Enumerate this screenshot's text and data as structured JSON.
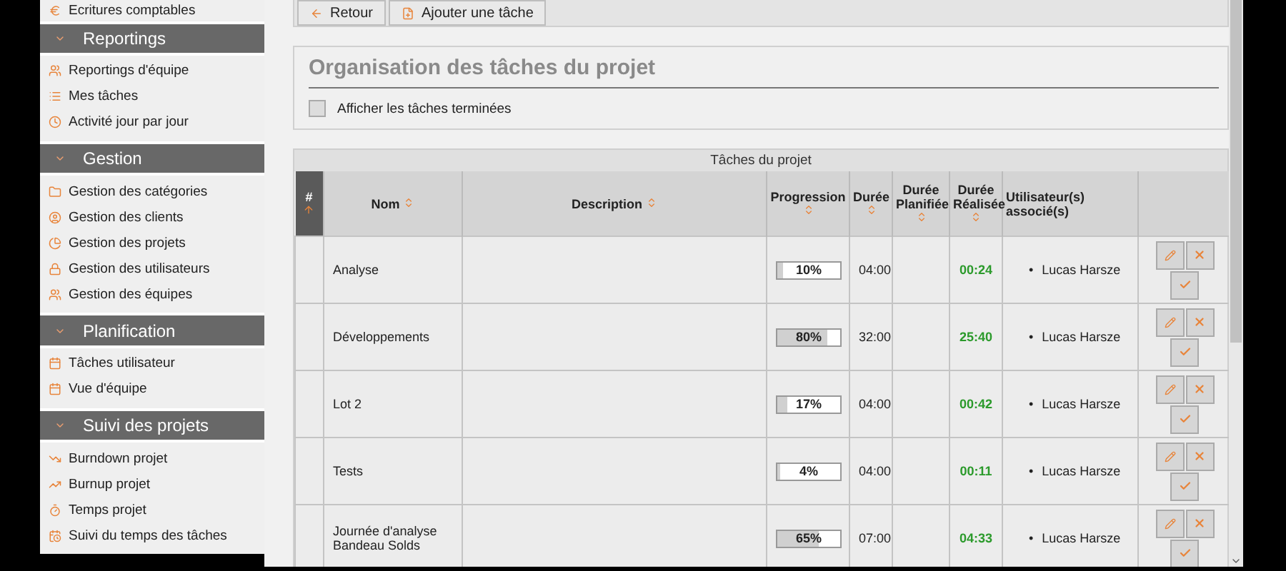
{
  "sidebar": {
    "top_items": [
      {
        "label": "Ecritures comptables"
      }
    ],
    "sections": [
      {
        "title": "Reportings",
        "expanded": true,
        "items": [
          {
            "label": "Reportings d'équipe"
          },
          {
            "label": "Mes tâches"
          },
          {
            "label": "Activité jour par jour"
          }
        ]
      },
      {
        "title": "Gestion",
        "expanded": true,
        "items": [
          {
            "label": "Gestion des catégories"
          },
          {
            "label": "Gestion des clients"
          },
          {
            "label": "Gestion des projets"
          },
          {
            "label": "Gestion des utilisateurs"
          },
          {
            "label": "Gestion des équipes"
          }
        ]
      },
      {
        "title": "Planification",
        "expanded": true,
        "items": [
          {
            "label": "Tâches utilisateur"
          },
          {
            "label": "Vue d'équipe"
          }
        ]
      },
      {
        "title": "Suivi des projets",
        "expanded": true,
        "items": [
          {
            "label": "Burndown projet"
          },
          {
            "label": "Burnup projet"
          },
          {
            "label": "Temps projet"
          },
          {
            "label": "Suivi du temps des tâches"
          }
        ]
      }
    ]
  },
  "toolbar": {
    "buttons": [
      {
        "label": "Retour"
      },
      {
        "label": "Ajouter une tâche"
      }
    ]
  },
  "panel": {
    "title": "Organisation des tâches du projet",
    "checkbox": {
      "label": "Afficher les tâches terminées",
      "checked": false
    }
  },
  "table": {
    "caption": "Tâches du projet",
    "columns": [
      {
        "label": "#",
        "sortable": true,
        "sorted": true
      },
      {
        "label": "Nom",
        "sortable": true,
        "sorted": false
      },
      {
        "label": "Description",
        "sortable": true,
        "sorted": false
      },
      {
        "label": "Progression",
        "sortable": true,
        "sorted": false
      },
      {
        "label": "Durée",
        "sortable": true,
        "sorted": false
      },
      {
        "label": "Durée Planifiée",
        "sortable": true,
        "sorted": false
      },
      {
        "label": "Durée Réalisée",
        "sortable": true,
        "sorted": false
      },
      {
        "label": "Utilisateur(s) associé(s)",
        "sortable": false,
        "sorted": false
      },
      {
        "sortable": false,
        "sorted": false
      }
    ],
    "rows": [
      {
        "name": "Analyse",
        "progress": {
          "level": 0.1,
          "text": "10%"
        },
        "duree": "04:00",
        "realisee": "00:24",
        "users": [
          {
            "marker": "•",
            "name": "Lucas Harsze"
          }
        ]
      },
      {
        "name": "Développements",
        "progress": {
          "level": 0.8,
          "text": "80%"
        },
        "duree": "32:00",
        "realisee": "25:40",
        "users": [
          {
            "marker": "•",
            "name": "Lucas Harsze"
          }
        ]
      },
      {
        "name": "Lot 2",
        "progress": {
          "level": 0.17,
          "text": "17%"
        },
        "duree": "04:00",
        "realisee": "00:42",
        "users": [
          {
            "marker": "•",
            "name": "Lucas Harsze"
          }
        ]
      },
      {
        "name": "Tests",
        "progress": {
          "level": 0.04,
          "text": "4%"
        },
        "duree": "04:00",
        "realisee": "00:11",
        "users": [
          {
            "marker": "•",
            "name": "Lucas Harsze"
          }
        ]
      },
      {
        "name": "Journée d'analyse Bandeau Solds",
        "progress": {
          "level": 0.65,
          "text": "65%"
        },
        "duree": "07:00",
        "realisee": "04:33",
        "users": [
          {
            "marker": "•",
            "name": "Lucas Harsze"
          }
        ]
      }
    ]
  }
}
